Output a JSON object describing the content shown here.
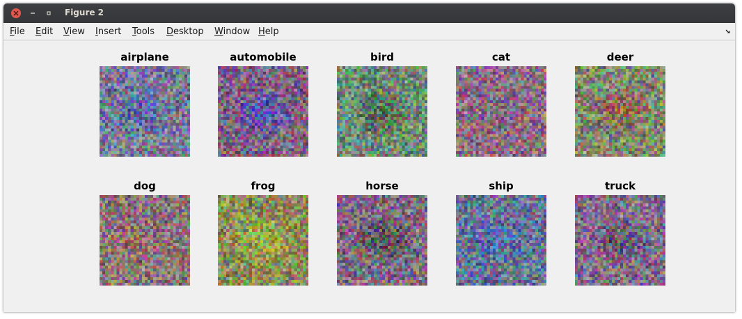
{
  "window": {
    "title": "Figure 2"
  },
  "menu": [
    {
      "key": "file",
      "mnemonic": "F",
      "rest": "ile"
    },
    {
      "key": "edit",
      "mnemonic": "E",
      "rest": "dit"
    },
    {
      "key": "view",
      "mnemonic": "V",
      "rest": "iew"
    },
    {
      "key": "insert",
      "mnemonic": "I",
      "rest": "nsert"
    },
    {
      "key": "tools",
      "mnemonic": "T",
      "rest": "ools"
    },
    {
      "key": "desktop",
      "mnemonic": "D",
      "rest": "esktop"
    },
    {
      "key": "window",
      "mnemonic": "W",
      "rest": "indow"
    },
    {
      "key": "help",
      "mnemonic": "H",
      "rest": "elp"
    }
  ],
  "panels": [
    {
      "title": "airplane",
      "base": [
        120,
        122,
        152
      ],
      "accent": [
        70,
        100,
        170
      ]
    },
    {
      "title": "automobile",
      "base": [
        128,
        100,
        128
      ],
      "accent": [
        70,
        80,
        200
      ]
    },
    {
      "title": "bird",
      "base": [
        115,
        140,
        118
      ],
      "accent": [
        60,
        90,
        60
      ]
    },
    {
      "title": "cat",
      "base": [
        142,
        110,
        132
      ],
      "accent": [
        130,
        100,
        120
      ]
    },
    {
      "title": "deer",
      "base": [
        130,
        138,
        110
      ],
      "accent": [
        150,
        80,
        70
      ]
    },
    {
      "title": "dog",
      "base": [
        138,
        118,
        120
      ],
      "accent": [
        170,
        110,
        110
      ]
    },
    {
      "title": "frog",
      "base": [
        140,
        138,
        92
      ],
      "accent": [
        170,
        190,
        60
      ]
    },
    {
      "title": "horse",
      "base": [
        128,
        110,
        128
      ],
      "accent": [
        60,
        60,
        60
      ]
    },
    {
      "title": "ship",
      "base": [
        105,
        118,
        150
      ],
      "accent": [
        80,
        100,
        180
      ]
    },
    {
      "title": "truck",
      "base": [
        128,
        112,
        136
      ],
      "accent": [
        90,
        70,
        110
      ]
    }
  ]
}
